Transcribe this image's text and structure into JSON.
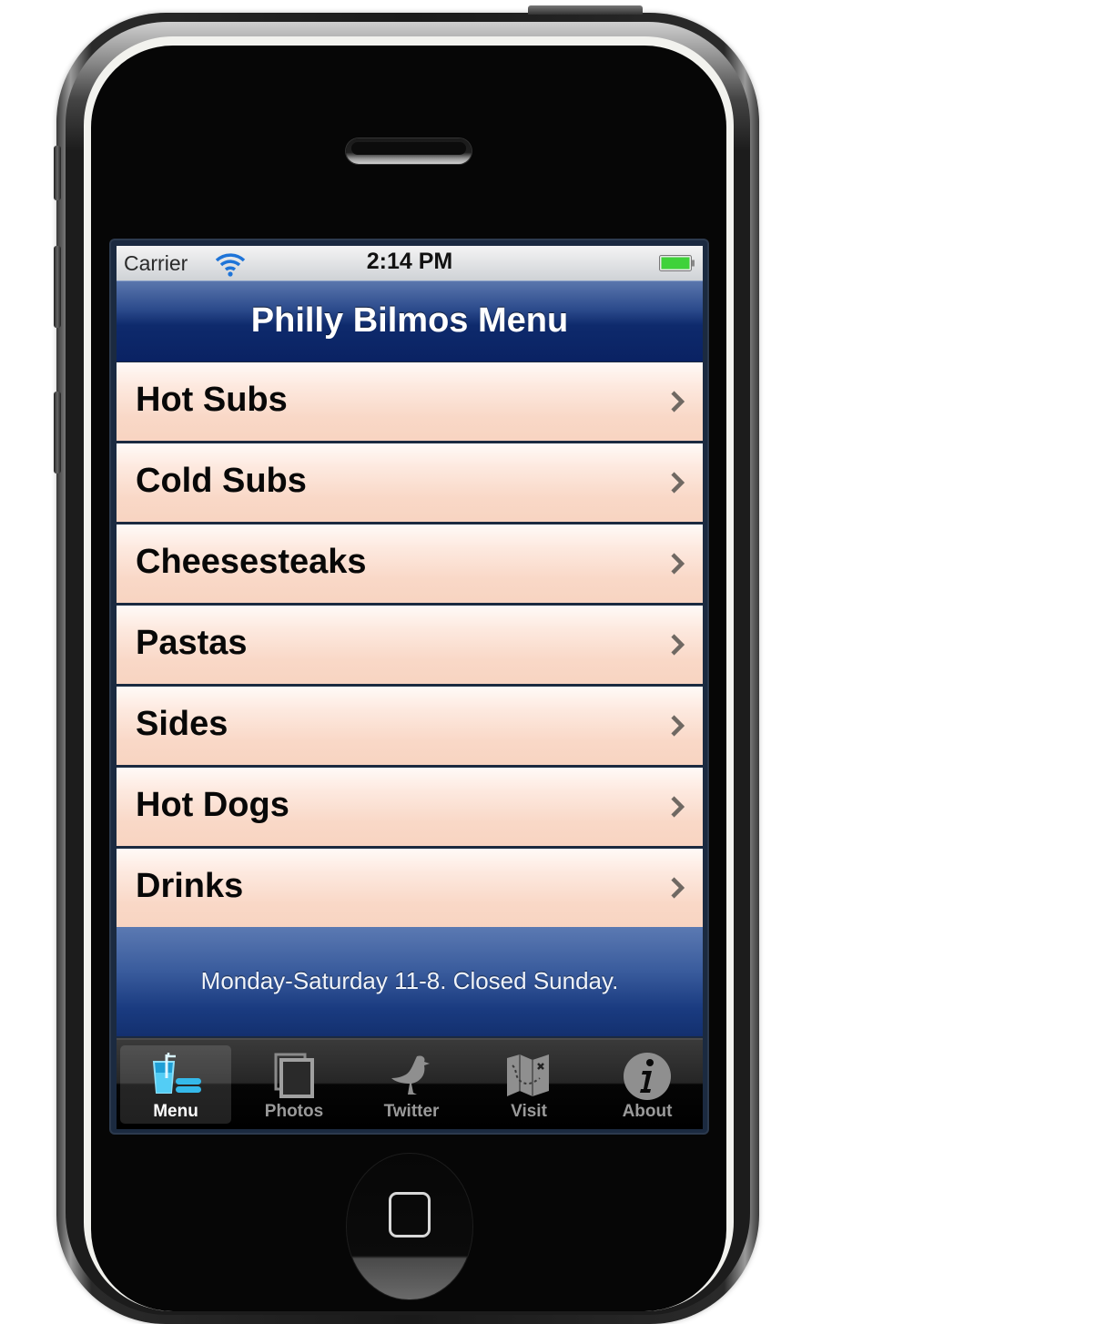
{
  "device": "iPhone",
  "status_bar": {
    "carrier": "Carrier",
    "time": "2:14 PM",
    "wifi_icon": "wifi-icon",
    "battery_icon": "battery-full-icon",
    "battery_color": "#3fd23a"
  },
  "nav_bar": {
    "title": "Philly Bilmos Menu",
    "color": "#0e2a6c"
  },
  "menu": {
    "row_color": "#f9d8c7",
    "items": [
      {
        "label": "Hot Subs"
      },
      {
        "label": "Cold Subs"
      },
      {
        "label": "Cheesesteaks"
      },
      {
        "label": "Pastas"
      },
      {
        "label": "Sides"
      },
      {
        "label": "Hot Dogs"
      },
      {
        "label": "Drinks"
      }
    ]
  },
  "footer": {
    "hours": "Monday-Saturday 11-8. Closed Sunday."
  },
  "tab_bar": {
    "active": "Menu",
    "active_icon_color": "#3cc0ee",
    "tabs": [
      {
        "label": "Menu",
        "icon": "drink-burger-icon"
      },
      {
        "label": "Photos",
        "icon": "photos-icon"
      },
      {
        "label": "Twitter",
        "icon": "bird-icon"
      },
      {
        "label": "Visit",
        "icon": "map-icon"
      },
      {
        "label": "About",
        "icon": "info-icon"
      }
    ]
  }
}
